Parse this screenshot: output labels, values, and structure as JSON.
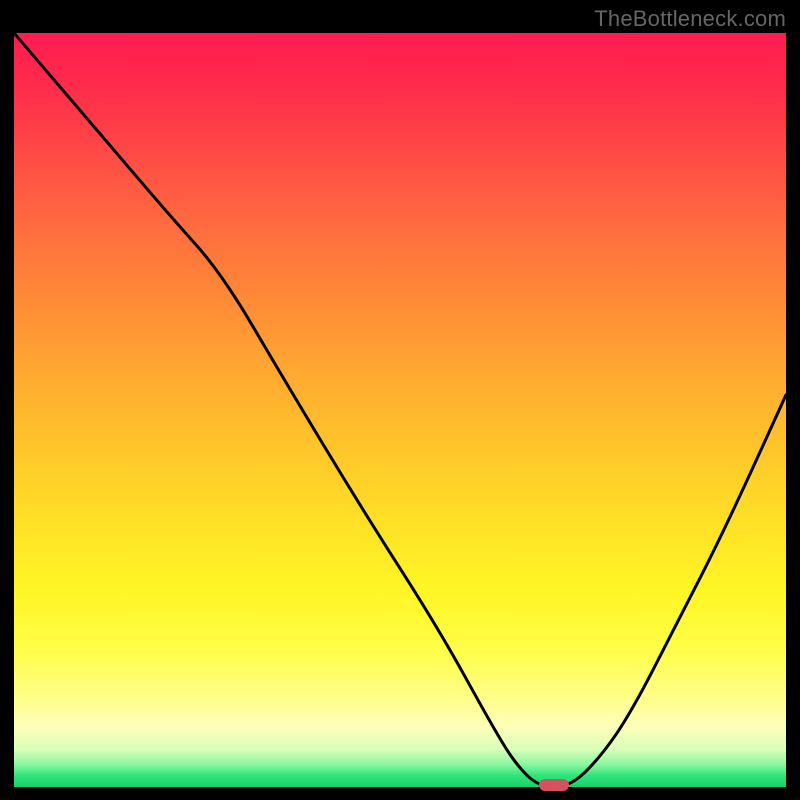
{
  "watermark": "TheBottleneck.com",
  "chart_data": {
    "type": "line",
    "title": "",
    "xlabel": "",
    "ylabel": "",
    "xlim": [
      0,
      100
    ],
    "ylim": [
      0,
      100
    ],
    "grid": false,
    "series": [
      {
        "name": "curve",
        "x": [
          0,
          10,
          20,
          27,
          35,
          45,
          55,
          62,
          65,
          68,
          72,
          76,
          80,
          86,
          92,
          100
        ],
        "values": [
          100,
          88,
          76,
          68,
          54,
          37,
          21,
          8,
          3,
          0,
          0,
          4,
          10,
          22,
          34,
          52
        ]
      }
    ],
    "marker": {
      "x": 70,
      "y": 0,
      "color": "#d45260"
    }
  }
}
